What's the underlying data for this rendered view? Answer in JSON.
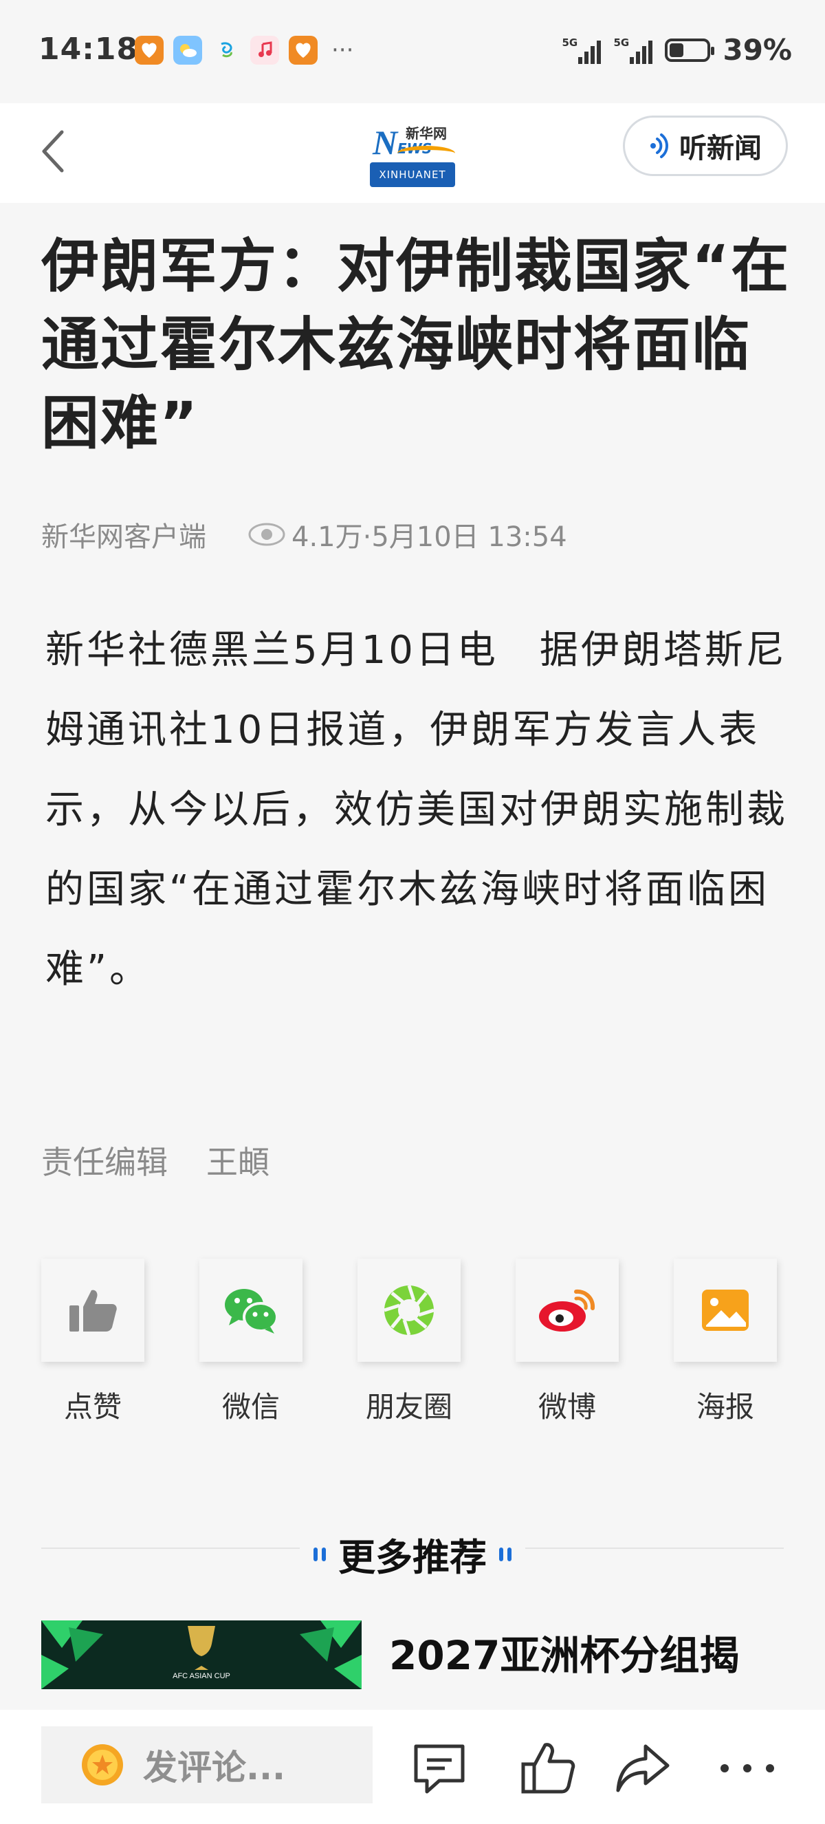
{
  "status_bar": {
    "time": "14:18",
    "signal1_label": "5G",
    "signal2_label": "5G",
    "battery_percent": "39%",
    "battery_level": 0.39,
    "more_notifications": "···"
  },
  "top_nav": {
    "logo_cn": "新华网",
    "logo_en": "XINHUANET",
    "listen_label": "听新闻"
  },
  "article": {
    "title": "伊朗军方：对伊制裁国家“在通过霍尔木兹海峡时将面临困难”",
    "source": "新华网客户端",
    "views_time": "4.1万·5月10日 13:54",
    "body": "新华社德黑兰5月10日电　据伊朗塔斯尼姆通讯社10日报道，伊朗军方发言人表示，从今以后，效仿美国对伊朗实施制裁的国家“在通过霍尔木兹海峡时将面临困难”。",
    "editor_label": "责任编辑",
    "editor_name": "王頔"
  },
  "share": {
    "items": [
      {
        "label": "点赞",
        "icon": "thumbs-up-icon"
      },
      {
        "label": "微信",
        "icon": "wechat-icon"
      },
      {
        "label": "朋友圈",
        "icon": "moments-icon"
      },
      {
        "label": "微博",
        "icon": "weibo-icon"
      },
      {
        "label": "海报",
        "icon": "poster-icon"
      }
    ]
  },
  "recommend": {
    "section_title": "更多推荐",
    "items": [
      {
        "title": "2027亚洲杯分组揭",
        "thumb_text": "AFC ASIAN CUP"
      }
    ]
  },
  "bottom_bar": {
    "comment_placeholder": "发评论..."
  }
}
